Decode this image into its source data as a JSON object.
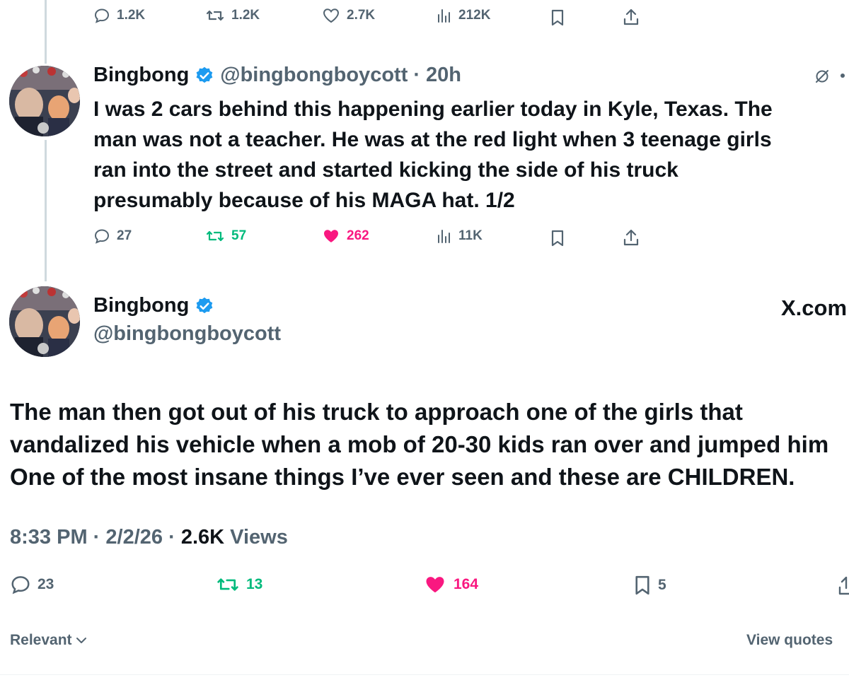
{
  "top_actions": {
    "replies": "1.2K",
    "reposts": "1.2K",
    "likes": "2.7K",
    "views": "212K"
  },
  "reply_tweet": {
    "name": "Bingbong",
    "handle": "@bingbongboycott",
    "separator": "·",
    "time": "20h",
    "text": "I was 2 cars behind this happening earlier today in Kyle, Texas. The man was not a teacher. He was at the red light when 3 teenage girls ran into the street and started kicking the side of his truck presumably because of his MAGA hat. 1/2",
    "lines": [
      "I was 2 cars behind this happening earlier today in Kyle, Texas. The",
      "man was not a teacher. He was at the red light when 3 teenage girls",
      "ran into the street and started kicking the side of his truck",
      "presumably because of his MAGA hat. 1/2"
    ],
    "actions": {
      "replies": "27",
      "reposts": "57",
      "likes": "262",
      "views": "11K"
    }
  },
  "main_tweet": {
    "name": "Bingbong",
    "handle": "@bingbongboycott",
    "brand": "X.com",
    "lines": [
      "The man then got out of his truck to approach one of the girls that",
      "vandalized his vehicle when a mob of 20-30 kids ran over and jumped him",
      "One of the most insane things I’ve ever seen and these are CHILDREN."
    ],
    "time": "8:33 PM",
    "date": "2/2/26",
    "views_count": "2.6K",
    "views_label": "Views",
    "actions": {
      "replies": "23",
      "reposts": "13",
      "likes": "164",
      "bookmarks": "5"
    }
  },
  "footer": {
    "sort_label": "Relevant",
    "view_quotes": "View quotes"
  },
  "colors": {
    "text": "#0f1419",
    "muted": "#536471",
    "repost_green": "#00ba7c",
    "like_pink": "#f91880",
    "verified_blue": "#1d9bf0"
  }
}
